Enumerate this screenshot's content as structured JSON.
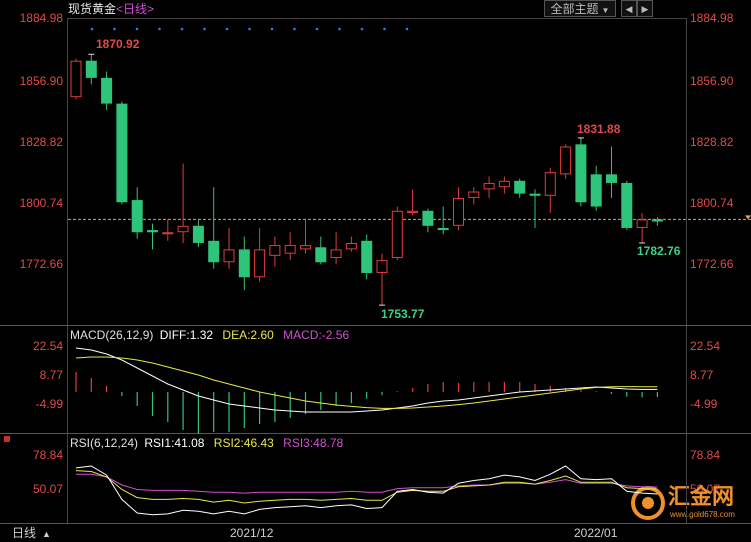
{
  "header": {
    "title": "现货黄金",
    "period_label": "<日线>",
    "theme_button": "全部主题",
    "theme_arrow": "▼",
    "prev_icon": "◀",
    "next_icon": "▶"
  },
  "bottom_bar": {
    "period": "日线",
    "period_arrow": "▲",
    "watermark_name": "汇金网",
    "watermark_url": "www.gold678.com"
  },
  "colors": {
    "up": "#e03c3c",
    "down": "#2ec47a",
    "diff": "#ffffff",
    "dea": "#e8e84a",
    "macd": "#d050d0",
    "rsi1": "#ffffff",
    "rsi2": "#e8e84a",
    "rsi3": "#d050d0",
    "dashed": "#e6a040",
    "watermark": "#f0902a"
  },
  "chart_data": [
    {
      "type": "candlestick",
      "title": "现货黄金 <日线>",
      "y_ticks": [
        "1884.98",
        "1856.90",
        "1828.82",
        "1800.74",
        "1772.66"
      ],
      "ylim": [
        1748,
        1887
      ],
      "x_labels": [
        "2021/12",
        "2022/01"
      ],
      "current_price_line": 1794,
      "annotations": [
        {
          "text": "1870.92",
          "bar": 1
        },
        {
          "text": "1831.88",
          "bar": 33
        },
        {
          "text": "1782.76",
          "bar": 37
        },
        {
          "text": "1753.77",
          "bar": 20
        }
      ],
      "bars": [
        {
          "o": 1851,
          "c": 1868,
          "h": 1869,
          "l": 1850
        },
        {
          "o": 1868,
          "c": 1860,
          "h": 1871,
          "l": 1857
        },
        {
          "o": 1860,
          "c": 1848,
          "h": 1863,
          "l": 1845
        },
        {
          "o": 1848,
          "c": 1802,
          "h": 1849,
          "l": 1801
        },
        {
          "o": 1803,
          "c": 1788,
          "h": 1809,
          "l": 1785
        },
        {
          "o": 1789,
          "c": 1788,
          "h": 1792,
          "l": 1780
        },
        {
          "o": 1788,
          "c": 1788,
          "h": 1794,
          "l": 1784
        },
        {
          "o": 1788,
          "c": 1791,
          "h": 1820,
          "l": 1783
        },
        {
          "o": 1791,
          "c": 1783,
          "h": 1794,
          "l": 1781
        },
        {
          "o": 1784,
          "c": 1774,
          "h": 1809,
          "l": 1771
        },
        {
          "o": 1774,
          "c": 1780,
          "h": 1790,
          "l": 1771
        },
        {
          "o": 1780,
          "c": 1767,
          "h": 1786,
          "l": 1761
        },
        {
          "o": 1767,
          "c": 1780,
          "h": 1790,
          "l": 1765
        },
        {
          "o": 1777,
          "c": 1782,
          "h": 1786,
          "l": 1772
        },
        {
          "o": 1778,
          "c": 1782,
          "h": 1788,
          "l": 1775
        },
        {
          "o": 1780,
          "c": 1782,
          "h": 1794,
          "l": 1778
        },
        {
          "o": 1781,
          "c": 1774,
          "h": 1786,
          "l": 1773
        },
        {
          "o": 1776,
          "c": 1780,
          "h": 1788,
          "l": 1773
        },
        {
          "o": 1780,
          "c": 1783,
          "h": 1786,
          "l": 1779
        },
        {
          "o": 1784,
          "c": 1769,
          "h": 1787,
          "l": 1766
        },
        {
          "o": 1769,
          "c": 1775,
          "h": 1778,
          "l": 1754
        },
        {
          "o": 1776,
          "c": 1798,
          "h": 1800,
          "l": 1775
        },
        {
          "o": 1797,
          "c": 1798,
          "h": 1808,
          "l": 1796
        },
        {
          "o": 1798,
          "c": 1791,
          "h": 1799,
          "l": 1788
        },
        {
          "o": 1790,
          "c": 1789,
          "h": 1800,
          "l": 1787
        },
        {
          "o": 1791,
          "c": 1804,
          "h": 1809,
          "l": 1789
        },
        {
          "o": 1804,
          "c": 1807,
          "h": 1809,
          "l": 1801
        },
        {
          "o": 1808,
          "c": 1811,
          "h": 1814,
          "l": 1804
        },
        {
          "o": 1809,
          "c": 1812,
          "h": 1814,
          "l": 1806
        },
        {
          "o": 1812,
          "c": 1806,
          "h": 1813,
          "l": 1804
        },
        {
          "o": 1806,
          "c": 1805,
          "h": 1808,
          "l": 1790
        },
        {
          "o": 1805,
          "c": 1816,
          "h": 1818,
          "l": 1797
        },
        {
          "o": 1815,
          "c": 1828,
          "h": 1829,
          "l": 1813
        },
        {
          "o": 1829,
          "c": 1802,
          "h": 1832,
          "l": 1800
        },
        {
          "o": 1815,
          "c": 1800,
          "h": 1819,
          "l": 1798
        },
        {
          "o": 1815,
          "c": 1811,
          "h": 1828,
          "l": 1804
        },
        {
          "o": 1811,
          "c": 1790,
          "h": 1812,
          "l": 1789
        },
        {
          "o": 1790,
          "c": 1794,
          "h": 1797,
          "l": 1783
        },
        {
          "o": 1794,
          "c": 1793,
          "h": 1795,
          "l": 1791
        }
      ]
    },
    {
      "type": "line+bar",
      "title": "MACD(26,12,9)",
      "legend": [
        {
          "label": "DIFF:1.32",
          "color_key": "diff"
        },
        {
          "label": "DEA:2.60",
          "color_key": "dea"
        },
        {
          "label": "MACD:-2.56",
          "color_key": "macd"
        }
      ],
      "y_ticks": [
        "22.54",
        "8.77",
        "-4.99"
      ],
      "ylim": [
        -13,
        26
      ],
      "series": [
        {
          "name": "DIFF",
          "values": [
            22,
            21,
            19,
            16,
            12,
            8,
            4,
            1,
            -2,
            -4,
            -6,
            -7,
            -8,
            -9,
            -9.5,
            -10,
            -10,
            -10,
            -10,
            -9.5,
            -9,
            -8,
            -7,
            -5.5,
            -4.5,
            -4,
            -3,
            -2,
            -1,
            0,
            0.5,
            1,
            1.5,
            2,
            2.5,
            2,
            1.5,
            1.3,
            1.32
          ]
        },
        {
          "name": "DEA",
          "values": [
            17,
            17.5,
            17.5,
            17,
            16,
            14.5,
            12.5,
            10.5,
            8.5,
            6,
            4,
            2,
            0,
            -1.5,
            -3,
            -4.5,
            -5.5,
            -6.5,
            -7.2,
            -7.8,
            -8.2,
            -8.2,
            -8,
            -7.5,
            -7,
            -6.3,
            -5.5,
            -4.5,
            -3.5,
            -2.5,
            -1.5,
            -0.5,
            0.5,
            1.5,
            2.3,
            2.6,
            2.7,
            2.65,
            2.6
          ]
        },
        {
          "name": "MACD",
          "values": [
            10,
            7,
            3,
            -2,
            -7,
            -12,
            -15,
            -19,
            -21,
            -20,
            -20,
            -18,
            -16,
            -15,
            -13,
            -11,
            -9,
            -7,
            -5.6,
            -3.4,
            -1.6,
            0.4,
            2,
            4,
            5,
            4.6,
            5,
            5,
            5,
            5,
            4,
            3,
            2,
            1,
            0.4,
            -1,
            -2.4,
            -2.7,
            -2.56
          ]
        }
      ]
    },
    {
      "type": "line",
      "title": "RSI(6,12,24)",
      "legend": [
        {
          "label": "RSI1:41.08",
          "color_key": "rsi1"
        },
        {
          "label": "RSI2:46.43",
          "color_key": "rsi2"
        },
        {
          "label": "RSI3:48.78",
          "color_key": "rsi3"
        }
      ],
      "y_ticks": [
        "78.84",
        "50.07"
      ],
      "ylim": [
        10,
        92
      ],
      "series": [
        {
          "name": "RSI1",
          "values": [
            70,
            72,
            62,
            35,
            20,
            18,
            19,
            23,
            22,
            19,
            22,
            19,
            24,
            26,
            27,
            28,
            26,
            28,
            29,
            25,
            26,
            44,
            46,
            43,
            42,
            53,
            56,
            58,
            62,
            60,
            56,
            63,
            72,
            58,
            57,
            58,
            44,
            42,
            41.08
          ]
        },
        {
          "name": "RSI2",
          "values": [
            67,
            66,
            60,
            46,
            37,
            35,
            35,
            36,
            35,
            32,
            34,
            31,
            33,
            34,
            35,
            35,
            34,
            35,
            36,
            34,
            34,
            43,
            45,
            44,
            44,
            49,
            50,
            51,
            54,
            54,
            52,
            56,
            61,
            54,
            54,
            54,
            48,
            47,
            46.43
          ]
        },
        {
          "name": "RSI3",
          "values": [
            63,
            63,
            60,
            51,
            46,
            45,
            45,
            45,
            44,
            43,
            43,
            42,
            43,
            43,
            43,
            43,
            43,
            43,
            44,
            43,
            43,
            47,
            48,
            48,
            48,
            50,
            51,
            51,
            53,
            53,
            52,
            54,
            57,
            53,
            53,
            53,
            50,
            49,
            48.78
          ]
        }
      ]
    }
  ]
}
